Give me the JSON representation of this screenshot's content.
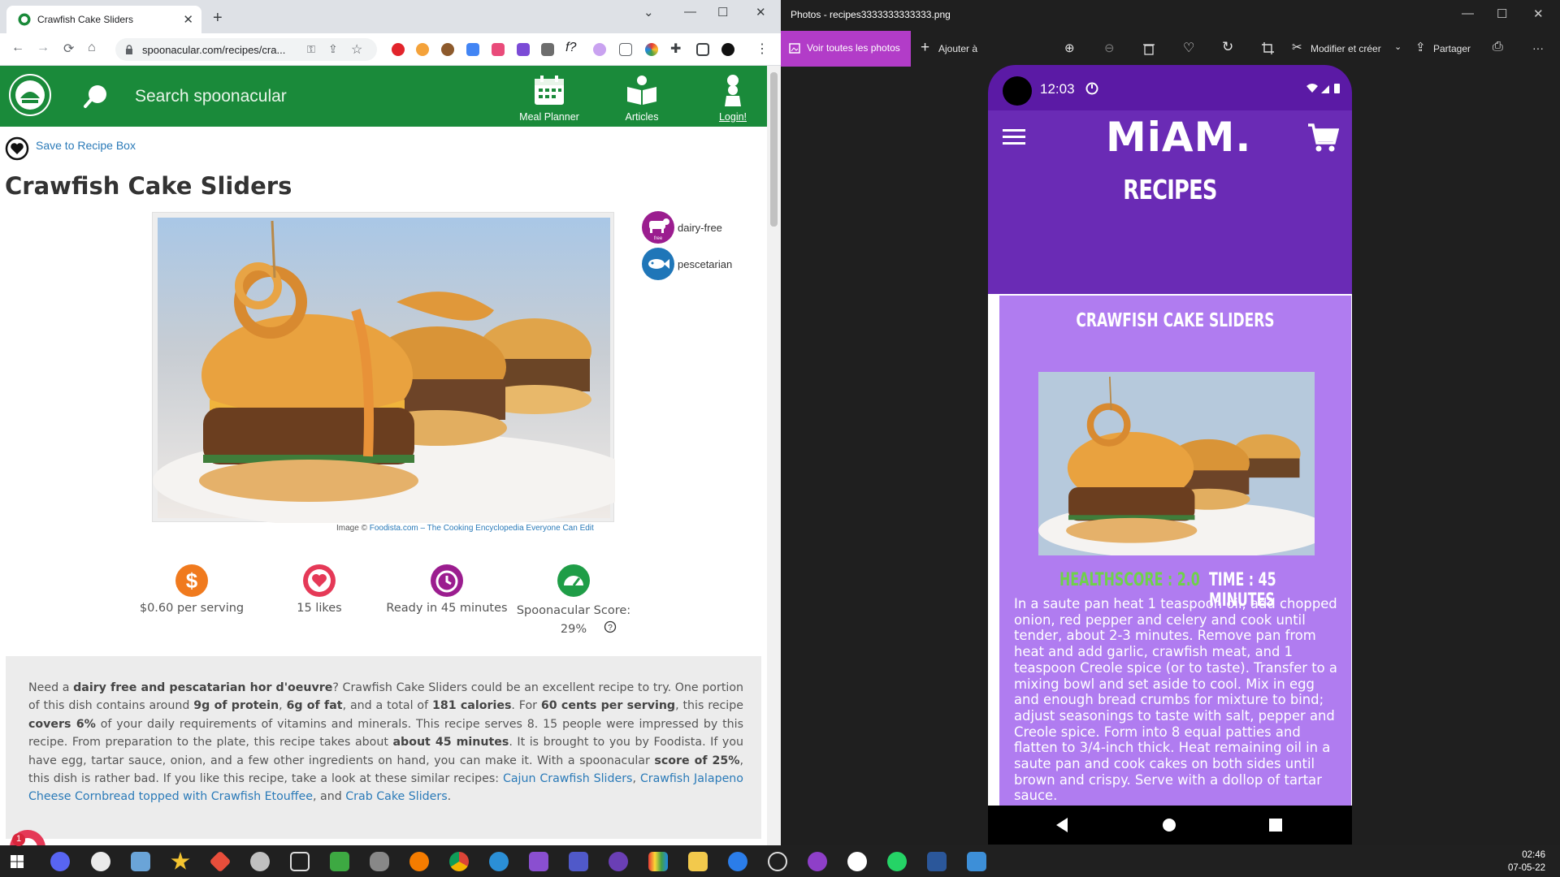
{
  "browser": {
    "tab_title": "Crawfish Cake Sliders",
    "tab_close": "✕",
    "new_tab": "+",
    "url": "spoonacular.com/recipes/cra...",
    "window_controls": [
      "⌄",
      "—",
      "☐",
      "✕"
    ]
  },
  "spoonacular": {
    "search_placeholder": "Search spoonacular",
    "nav": [
      {
        "label": "Meal Planner",
        "icon": "calendar-icon"
      },
      {
        "label": "Articles",
        "icon": "book-icon"
      },
      {
        "label": "Login!",
        "icon": "chef-icon"
      }
    ],
    "save_label": "Save to Recipe Box",
    "title": "Crawfish Cake Sliders",
    "image_credit_prefix": "Image © ",
    "image_credit_link": "Foodista.com – The Cooking Encyclopedia Everyone Can Edit",
    "badges": [
      {
        "label": "dairy-free",
        "color": "#9b1d8f",
        "icon": "cow-free-icon"
      },
      {
        "label": "pescetarian",
        "color": "#1f76b8",
        "icon": "fish-icon"
      }
    ],
    "stats": [
      {
        "label": "$0.60 per serving",
        "color": "#f07a1e",
        "icon": "dollar-icon"
      },
      {
        "label": "15 likes",
        "color": "#e53957",
        "icon": "heart-icon"
      },
      {
        "label": "Ready in 45 minutes",
        "color": "#9b1d8f",
        "icon": "clock-icon"
      },
      {
        "label": "Spoonacular Score: 29%",
        "color": "#1f9d47",
        "icon": "gauge-icon"
      }
    ],
    "description": {
      "p1": "Need a ",
      "b1": "dairy free and pescatarian hor d'oeuvre",
      "p2": "? Crawfish Cake Sliders could be an excellent recipe to try. One portion of this dish contains around ",
      "b2": "9g of protein",
      "p3": ", ",
      "b3": "6g of fat",
      "p4": ", and a total of ",
      "b4": "181 calories",
      "p5": ". For ",
      "b5": "60 cents per serving",
      "p6": ", this recipe ",
      "b6": "covers 6%",
      "p7": " of your daily requirements of vitamins and minerals. This recipe serves 8. 15 people were impressed by this recipe. From preparation to the plate, this recipe takes about ",
      "b7": "about 45 minutes",
      "p8": ". It is brought to you by Foodista. If you have egg, tartar sauce, onion, and a few other ingredients on hand, you can make it. With a spoonacular ",
      "b8": "score of 25%",
      "p9": ", this dish is rather bad. If you like this recipe, take a look at these similar recipes: ",
      "l1": "Cajun Crawfish Sliders",
      "p10": ", ",
      "l2": "Crawfish Jalapeno Cheese Cornbread topped with Crawfish Etouffee",
      "p11": ", and ",
      "l3": "Crab Cake Sliders",
      "p12": "."
    }
  },
  "photos": {
    "title": "Photos - recipes3333333333333.png",
    "see_all": "Voir toutes les photos",
    "add": "Ajouter à",
    "edit": "Modifier et créer",
    "share": "Partager",
    "more": "···"
  },
  "phone": {
    "time": "12:03",
    "brand": "MiAM.",
    "heading": "RECIPES",
    "card_title": "CRAWFISH CAKE SLIDERS",
    "healthscore": "HEALTHSCORE : 2.0",
    "time_label": "TIME : 45 MINUTES",
    "instructions": "In a saute pan heat 1 teaspoon oil, add chopped onion, red pepper and celery and cook until tender, about 2-3 minutes. Remove pan from heat and add garlic, crawfish meat, and 1 teaspoon Creole spice (or to taste). Transfer to a mixing bowl and set aside to cool. Mix in egg and enough bread crumbs for mixture to bind; adjust seasonings to taste with salt, pepper and Creole spice. Form into 8 equal patties and flatten to 3/4-inch thick. Heat remaining oil in a saute pan and cook cakes on both sides until brown and crispy. Serve with a dollop of tartar sauce."
  },
  "taskbar": {
    "time": "02:46",
    "date": "07-05-22",
    "notification_count": "1",
    "accent": "#202020"
  }
}
